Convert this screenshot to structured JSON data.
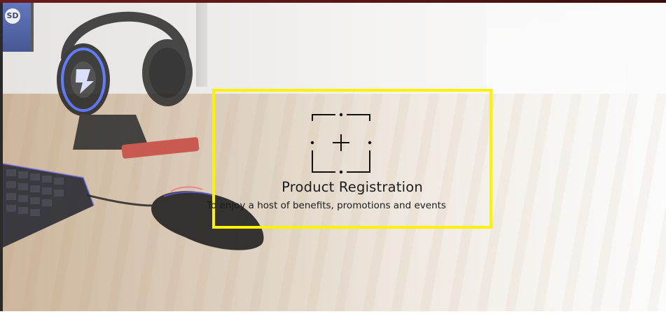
{
  "registration": {
    "title": "Product Registration",
    "subtitle": "To enjoy a host of benefits, promotions and events",
    "icon": "product-scan-plus-icon",
    "highlight_color": "#fff200"
  },
  "background": {
    "monitor_badge": "SD"
  },
  "colors": {
    "top_strip": "#5a1414",
    "text": "#1b1b1b"
  }
}
